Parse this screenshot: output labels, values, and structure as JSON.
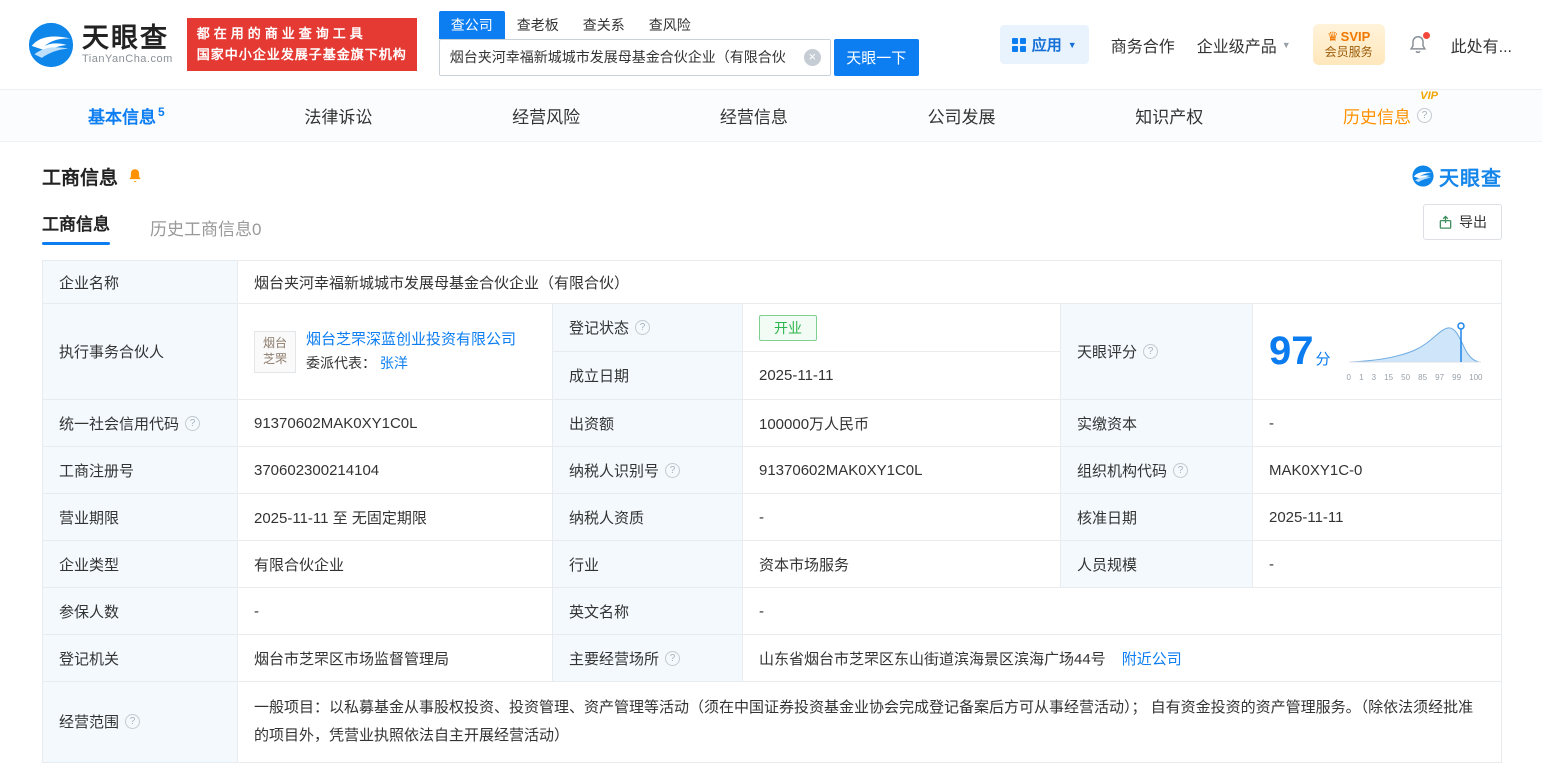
{
  "header": {
    "logo": {
      "brand": "天眼查",
      "domain": "TianYanCha.com"
    },
    "slogan": {
      "line1": "都在用的商业查询工具",
      "line2": "国家中小企业发展子基金旗下机构"
    },
    "search": {
      "tabs": [
        {
          "label": "查公司"
        },
        {
          "label": "查老板"
        },
        {
          "label": "查关系"
        },
        {
          "label": "查风险"
        }
      ],
      "value": "烟台夹河幸福新城城市发展母基金合伙企业（有限合伙",
      "button": "天眼一下"
    },
    "nav": {
      "apps": "应用",
      "cooperation": "商务合作",
      "products": "企业级产品",
      "svip_line1": "SVIP",
      "svip_line2": "会员服务",
      "user": "此处有..."
    }
  },
  "tabs": [
    {
      "label": "基本信息",
      "badge": "5"
    },
    {
      "label": "法律诉讼"
    },
    {
      "label": "经营风险"
    },
    {
      "label": "经营信息"
    },
    {
      "label": "公司发展"
    },
    {
      "label": "知识产权"
    },
    {
      "label": "历史信息",
      "tag": "VIP"
    }
  ],
  "section": {
    "title": "工商信息",
    "watermark": "天眼查",
    "subtabs": [
      {
        "label": "工商信息"
      },
      {
        "label": "历史工商信息0"
      }
    ],
    "export": "导出"
  },
  "fields": {
    "name": {
      "label": "企业名称",
      "value": "烟台夹河幸福新城城市发展母基金合伙企业（有限合伙）"
    },
    "partner": {
      "label": "执行事务合伙人",
      "company": "烟台芝罘深蓝创业投资有限公司",
      "logo_line1": "烟台",
      "logo_line2": "芝罘",
      "rep_label": "委派代表：",
      "rep": "张洋"
    },
    "status": {
      "label": "登记状态",
      "value": "开业"
    },
    "founded": {
      "label": "成立日期",
      "value": "2025-11-11"
    },
    "credit_code": {
      "label": "统一社会信用代码",
      "value": "91370602MAK0XY1C0L"
    },
    "capital": {
      "label": "出资额",
      "value": "100000万人民币"
    },
    "paid_capital": {
      "label": "实缴资本",
      "value": "-"
    },
    "reg_no": {
      "label": "工商注册号",
      "value": "370602300214104"
    },
    "taxpayer_id": {
      "label": "纳税人识别号",
      "value": "91370602MAK0XY1C0L"
    },
    "org_code": {
      "label": "组织机构代码",
      "value": "MAK0XY1C-0"
    },
    "term": {
      "label": "营业期限",
      "value": "2025-11-11 至 无固定期限"
    },
    "taxpayer_quality": {
      "label": "纳税人资质",
      "value": "-"
    },
    "approval_date": {
      "label": "核准日期",
      "value": "2025-11-11"
    },
    "type": {
      "label": "企业类型",
      "value": "有限合伙企业"
    },
    "industry": {
      "label": "行业",
      "value": "资本市场服务"
    },
    "staff": {
      "label": "人员规模",
      "value": "-"
    },
    "insured": {
      "label": "参保人数",
      "value": "-"
    },
    "english_name": {
      "label": "英文名称",
      "value": "-"
    },
    "authority": {
      "label": "登记机关",
      "value": "烟台市芝罘区市场监督管理局"
    },
    "address": {
      "label": "主要经营场所",
      "value": "山东省烟台市芝罘区东山街道滨海景区滨海广场44号",
      "link": "附近公司"
    },
    "scope": {
      "label": "经营范围",
      "value": "一般项目：以私募基金从事股权投资、投资管理、资产管理等活动（须在中国证券投资基金业协会完成登记备案后方可从事经营活动）； 自有资金投资的资产管理服务。（除依法须经批准的项目外，凭营业执照依法自主开展经营活动）"
    }
  },
  "score": {
    "label": "天眼评分",
    "value": "97",
    "unit": "分",
    "axis": [
      "0",
      "1",
      "3",
      "15",
      "50",
      "85",
      "97",
      "99",
      "100"
    ]
  },
  "colors": {
    "brand_blue": "#0c7ef2",
    "banner_red": "#e53a33",
    "status_green": "#2db54d",
    "vip_orange": "#ff9100"
  }
}
